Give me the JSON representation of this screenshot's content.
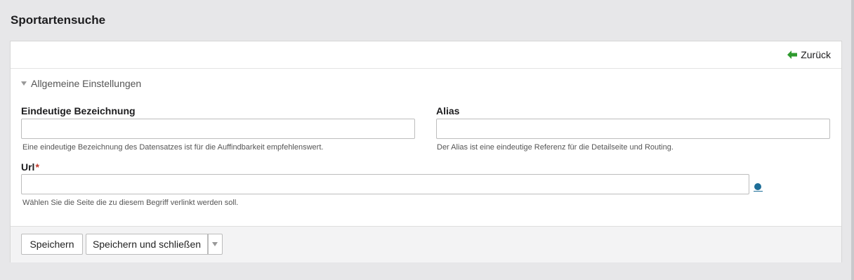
{
  "page": {
    "title": "Sportartensuche"
  },
  "toolbar": {
    "back_label": "Zurück",
    "back_icon": "arrow-left-icon"
  },
  "section": {
    "title": "Allgemeine Einstellungen",
    "expanded": true
  },
  "fields": {
    "bezeichnung": {
      "label": "Eindeutige Bezeichnung",
      "value": "",
      "help": "Eine eindeutige Bezeichnung des Datensatzes ist für die Auffindbarkeit empfehlenswert."
    },
    "alias": {
      "label": "Alias",
      "value": "",
      "help": "Der Alias ist eine eindeutige Referenz für die Detailseite und Routing."
    },
    "url": {
      "label": "Url",
      "required_marker": "*",
      "value": "",
      "help": "Wählen Sie die Seite die zu diesem Begriff verlinkt werden soll."
    }
  },
  "footer": {
    "save_label": "Speichern",
    "save_close_label": "Speichern und schließen"
  },
  "colors": {
    "accent_green": "#2e9a2e",
    "link_blue": "#1e6e98",
    "required_red": "#c0392b"
  }
}
